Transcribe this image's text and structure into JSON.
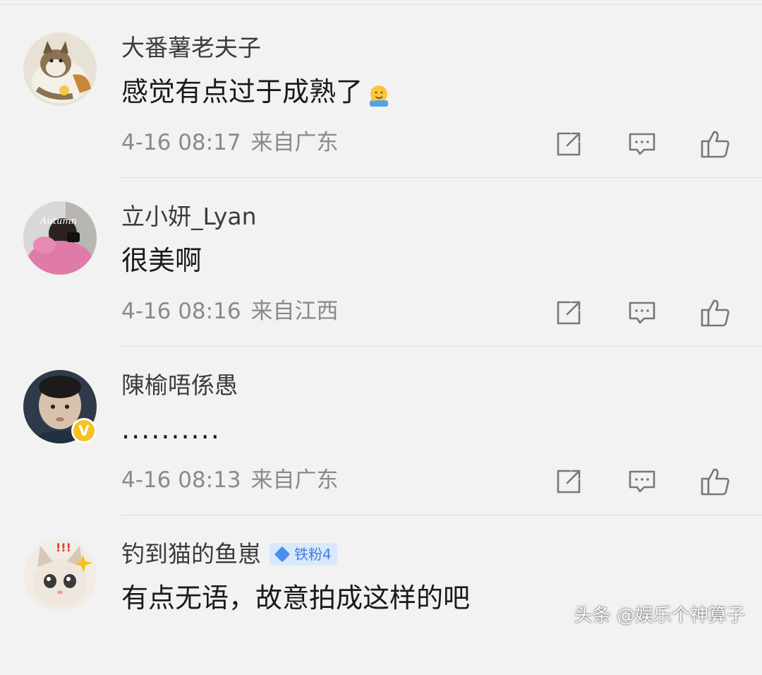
{
  "comments": [
    {
      "username": "大番薯老夫子",
      "content": "感觉有点过于成熟了",
      "emoji": "smile-cover-face-emoji",
      "time": "4-16 08:17",
      "location": "来自广东"
    },
    {
      "username": "立小妍_Lyan",
      "content": "很美啊",
      "time": "4-16 08:16",
      "location": "来自江西",
      "avatar_text": "Autumn"
    },
    {
      "username": "陳榆唔係愚",
      "content": "..........",
      "time": "4-16 08:13",
      "location": "来自广东",
      "verified_badge": "V"
    },
    {
      "username": "钓到猫的鱼崽",
      "content": "有点无语，故意拍成这样的吧",
      "fan_badge": "铁粉4",
      "time": "",
      "location": ""
    }
  ],
  "icons": {
    "share": "share-icon",
    "reply": "comment-icon",
    "like": "thumbs-up-icon"
  },
  "watermark": "头条 @娱乐个神算子",
  "colors": {
    "background": "#f2f2f2",
    "meta_text": "#8a8a8a",
    "verified_badge": "#f5c322",
    "fan_badge_text": "#3b7fe0"
  }
}
